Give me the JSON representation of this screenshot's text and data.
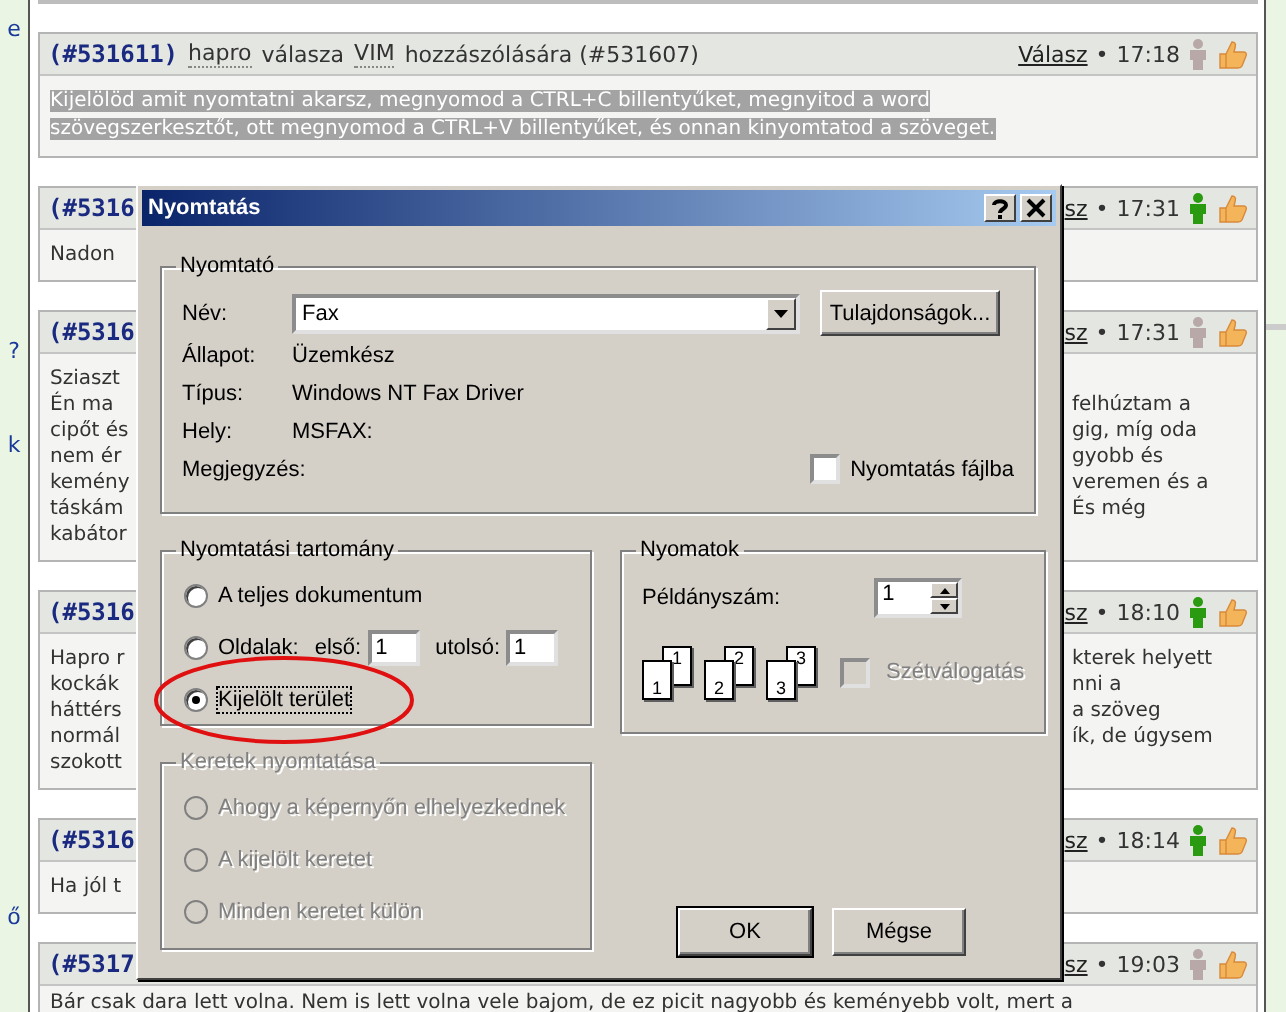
{
  "sidebar": {
    "items": [
      "e",
      "?",
      "k",
      "ő"
    ]
  },
  "posts": [
    {
      "id": "(#531611)",
      "author": "hapro",
      "verb": "válasza",
      "target": "VIM",
      "target_tail": "hozzászólására (#531607)",
      "reply": "Válasz",
      "separator": "•",
      "time": "17:18",
      "online": false,
      "selected": true,
      "lines": [
        {
          "left": "Kijelölöd amit nyomtatni akarsz, megnyomod a CTRL+C billentyűket, megnyitod a word"
        },
        {
          "left": "szövegszerkesztőt, ott megnyomod a CTRL+V billentyűket, és onnan kinyomtatod a szöveget."
        }
      ]
    },
    {
      "id": "(#5316",
      "reply": "sz",
      "separator": "•",
      "time": "17:31",
      "online": true,
      "selected": false,
      "lines": [
        {
          "left": "Nadon"
        }
      ]
    },
    {
      "id": "(#5316",
      "reply": "sz",
      "separator": "•",
      "time": "17:31",
      "online": false,
      "selected": false,
      "lines": [
        {
          "left": "Sziaszt"
        },
        {
          "left": "Én ma",
          "right": "felhúztam a"
        },
        {
          "left": "cipőt és",
          "right": "gig, míg oda"
        },
        {
          "left": "nem ér",
          "right": "gyobb és"
        },
        {
          "left": "kemény",
          "right": "veremen és a"
        },
        {
          "left": "táskám",
          "right": "És még"
        },
        {
          "left": "kabátor"
        }
      ]
    },
    {
      "id": "(#5316",
      "reply": "sz",
      "separator": "•",
      "time": "18:10",
      "online": true,
      "selected": false,
      "lines": [
        {
          "left": "Hapro r",
          "right": "kterek helyett"
        },
        {
          "left": "kockák",
          "right": "nni a"
        },
        {
          "left": "háttérs",
          "right": "a szöveg"
        },
        {
          "left": "normál",
          "right": "ík, de úgysem"
        },
        {
          "left": "szokott"
        }
      ]
    },
    {
      "id": "(#5316",
      "reply": "sz",
      "separator": "•",
      "time": "18:14",
      "online": true,
      "selected": false,
      "lines": [
        {
          "left": "Ha jól t"
        }
      ]
    },
    {
      "id": "(#5317",
      "reply": "sz",
      "separator": "•",
      "time": "19:03",
      "online": false,
      "selected": false,
      "lines": [
        {
          "left": "Bár csak dara lett volna. Nem is lett volna vele bajom, de ez picit nagyobb és keményebb volt, mert a"
        }
      ]
    }
  ],
  "dialog": {
    "title": "Nyomtatás",
    "printer": {
      "legend": "Nyomtató",
      "name_label": "Név:",
      "name_value": "Fax",
      "properties_button": "Tulajdonságok...",
      "info": [
        {
          "label": "Állapot:",
          "value": "Üzemkész"
        },
        {
          "label": "Típus:",
          "value": "Windows NT Fax Driver"
        },
        {
          "label": "Hely:",
          "value": "MSFAX:"
        },
        {
          "label": "Megjegyzés:"
        }
      ],
      "print_to_file": {
        "label": "Nyomtatás fájlba",
        "checked": false
      }
    },
    "range": {
      "legend": "Nyomtatási tartomány",
      "options": [
        {
          "kind": "plain",
          "label": "A teljes dokumentum",
          "selected": false,
          "circled": false
        },
        {
          "kind": "pages",
          "label": "Oldalak:",
          "from_label": "első:",
          "from_value": "1",
          "to_label": "utolsó:",
          "to_value": "1",
          "selected": false,
          "circled": false
        },
        {
          "kind": "plain",
          "label": "Kijelölt terület",
          "selected": true,
          "circled": true
        }
      ]
    },
    "frames": {
      "legend": "Keretek nyomtatása",
      "disabled": true,
      "options": [
        {
          "label": "Ahogy a képernyőn elhelyezkednek",
          "selected": false
        },
        {
          "label": "A kijelölt keretet",
          "selected": false
        },
        {
          "label": "Minden keretet külön",
          "selected": false
        }
      ]
    },
    "copies": {
      "legend": "Nyomatok",
      "count_label": "Példányszám:",
      "count_value": "1",
      "collate_pages": [
        {
          "back": "1",
          "front": "1"
        },
        {
          "back": "2",
          "front": "2"
        },
        {
          "back": "3",
          "front": "3"
        }
      ],
      "collate": {
        "label": "Szétválogatás",
        "checked": false,
        "disabled": true
      }
    },
    "buttons": [
      {
        "label": "OK",
        "default": true
      },
      {
        "label": "Mégse",
        "default": false
      }
    ]
  }
}
